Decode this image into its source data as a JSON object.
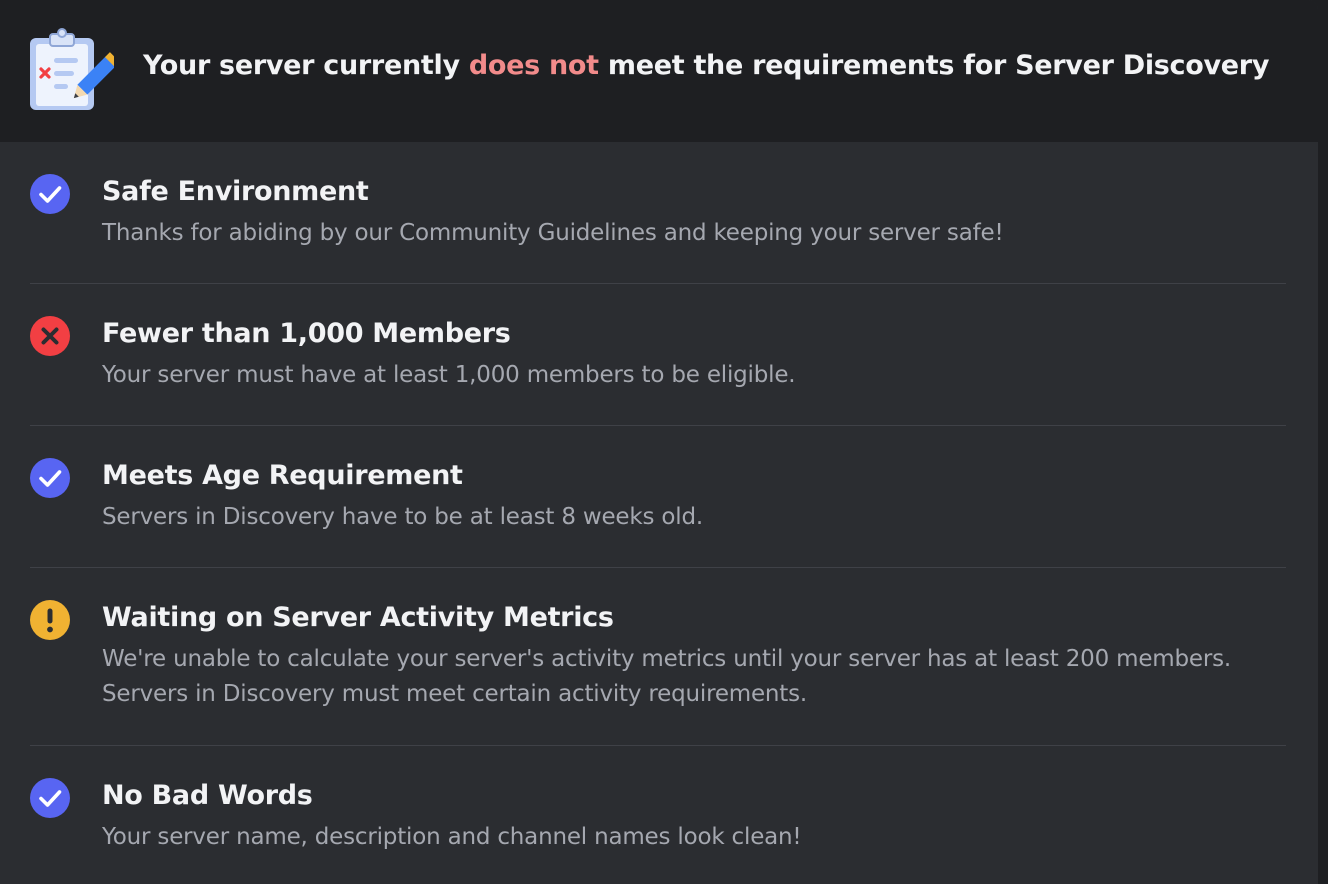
{
  "header": {
    "icon": "clipboard-checklist-icon",
    "title_before": "Your server currently ",
    "title_emphasis": "does not",
    "title_after": " meet the requirements for Server Discovery",
    "emphasis_color": "#f28b8b"
  },
  "requirements": [
    {
      "status": "pass",
      "icon": "check-circle-icon",
      "title": "Safe Environment",
      "description_line1": "Thanks for abiding by our Community Guidelines and keeping your server safe!"
    },
    {
      "status": "fail",
      "icon": "x-circle-icon",
      "title": "Fewer than 1,000 Members",
      "description_line1": "Your server must have at least 1,000 members to be eligible."
    },
    {
      "status": "pass",
      "icon": "check-circle-icon",
      "title": "Meets Age Requirement",
      "description_line1": "Servers in Discovery have to be at least 8 weeks old."
    },
    {
      "status": "warning",
      "icon": "exclamation-circle-icon",
      "title": "Waiting on Server Activity Metrics",
      "description_line1": "We're unable to calculate your server's activity metrics until your server has at least 200 members.",
      "description_line2": "Servers in Discovery must meet certain activity requirements."
    },
    {
      "status": "pass",
      "icon": "check-circle-icon",
      "title": "No Bad Words",
      "description_line1": "Your server name, description and channel names look clean!"
    }
  ],
  "colors": {
    "pass": "#5865f2",
    "fail": "#f23f43",
    "warning": "#f0b232",
    "header_bg": "#1e1f22",
    "panel_bg": "#2b2d31"
  }
}
